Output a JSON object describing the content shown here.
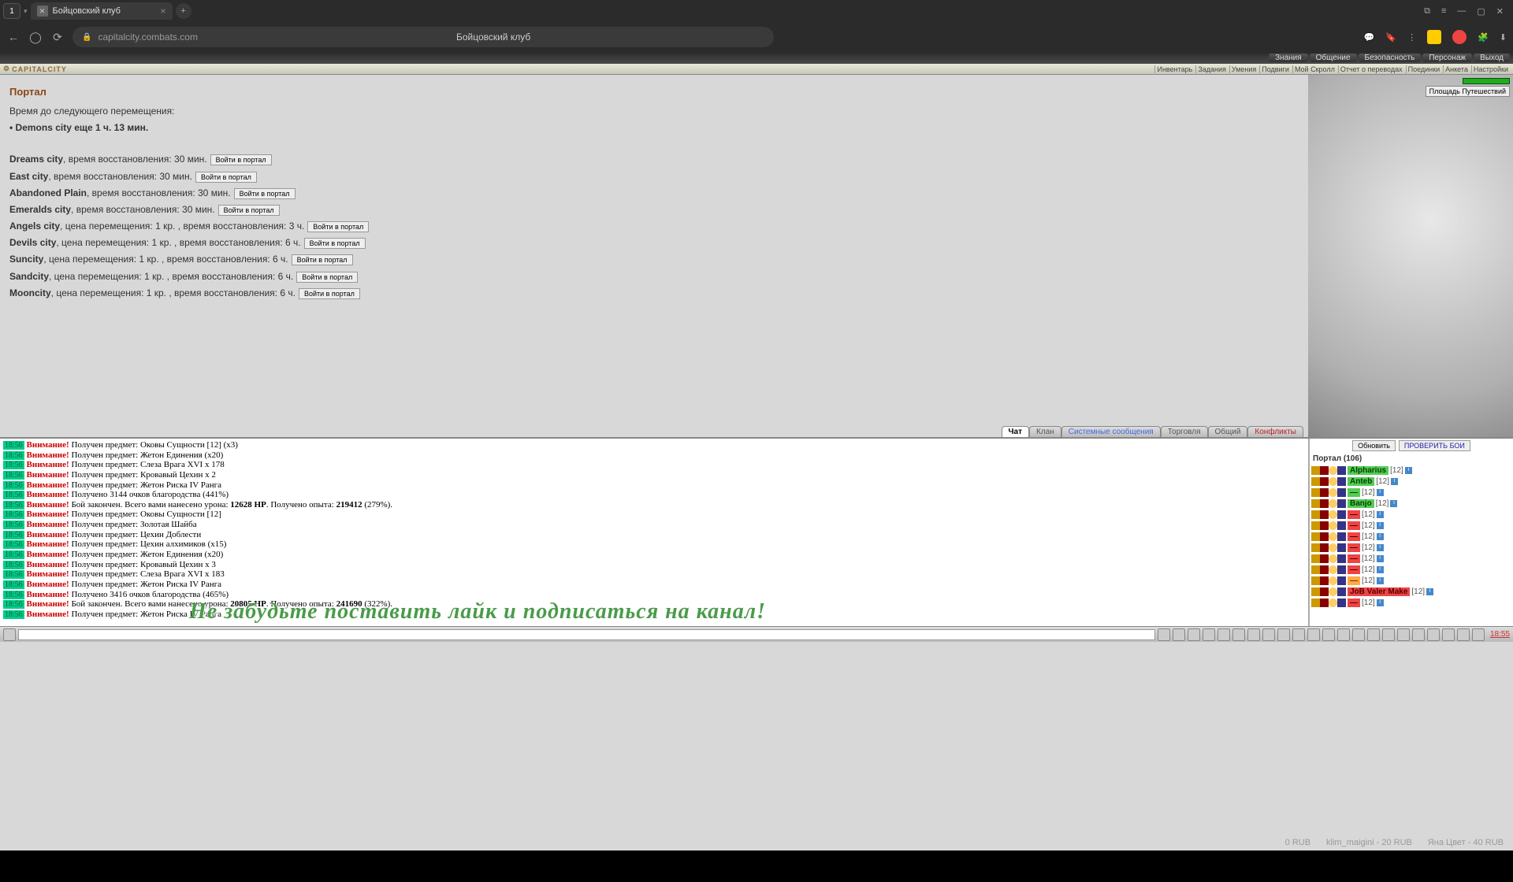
{
  "browser": {
    "profile_num": "1",
    "tab_title": "Бойцовский клуб",
    "url": "capitalcity.combats.com",
    "page_label": "Бойцовский клуб"
  },
  "game_topnav": [
    "Знания",
    "Общение",
    "Безопасность",
    "Персонаж",
    "Выход"
  ],
  "game_menubar_logo": "CAPITALCITY",
  "game_menubar": [
    "Инвентарь",
    "Задания",
    "Умения",
    "Подвиги",
    "Мой Скролл",
    "Отчет о переводах",
    "Поединки",
    "Анкета",
    "Настройки"
  ],
  "portal": {
    "title": "Портал",
    "next_label": "Время до следующего перемещения:",
    "next_line": "• Demons city еще 1 ч. 13 мин.",
    "enter_label": "Войти в портал",
    "dests": [
      {
        "name": "Dreams city",
        "rest": ", время восстановления: 30 мин."
      },
      {
        "name": "East city",
        "rest": ", время восстановления: 30 мин."
      },
      {
        "name": "Abandoned Plain",
        "rest": ", время восстановления: 30 мин."
      },
      {
        "name": "Emeralds city",
        "rest": ", время восстановления: 30 мин."
      },
      {
        "name": "Angels city",
        "rest": ", цена перемещения: 1 кр. , время восстановления: 3 ч."
      },
      {
        "name": "Devils city",
        "rest": ", цена перемещения: 1 кр. , время восстановления: 6 ч."
      },
      {
        "name": "Suncity",
        "rest": ", цена перемещения: 1 кр. , время восстановления: 6 ч."
      },
      {
        "name": "Sandcity",
        "rest": ", цена перемещения: 1 кр. , время восстановления: 6 ч."
      },
      {
        "name": "Mooncity",
        "rest": ", цена перемещения: 1 кр. , время восстановления: 6 ч."
      }
    ]
  },
  "scene": {
    "loc_button": "Площадь Путешествий"
  },
  "market": [
    "0 RUB",
    "klim_maigini - 20 RUB",
    "Яна Цвет - 40 RUB"
  ],
  "chat_tabs": [
    "Чат",
    "Клан",
    "Системные сообщения",
    "Торговля",
    "Общий",
    "Конфликты"
  ],
  "chat_log": [
    {
      "t": "18:56",
      "w": "Внимание!",
      "m": " Получен предмет: Оковы Сущности [12] (x3)"
    },
    {
      "t": "18:56",
      "w": "Внимание!",
      "m": " Получен предмет: Жетон Единения (x20)"
    },
    {
      "t": "18:56",
      "w": "Внимание!",
      "m": " Получен предмет: Слеза Врага XVI x 178"
    },
    {
      "t": "18:56",
      "w": "Внимание!",
      "m": " Получен предмет: Кровавый Цехин x 2"
    },
    {
      "t": "18:56",
      "w": "Внимание!",
      "m": " Получен предмет: Жетон Риска IV Ранга"
    },
    {
      "t": "18:56",
      "w": "Внимание!",
      "m": " Получено 3144 очков благородства (441%)"
    },
    {
      "t": "18:56",
      "w": "Внимание!",
      "m_pre": " Бой закончен. Всего вами нанесено урона: ",
      "hp": "12628 HP",
      "m_mid": ". Получено опыта: ",
      "exp": "219412",
      "m_post": " (279%)."
    },
    {
      "t": "18:56",
      "w": "Внимание!",
      "m": " Получен предмет: Оковы Сущности [12]"
    },
    {
      "t": "18:56",
      "w": "Внимание!",
      "m": " Получен предмет: Золотая Шайба"
    },
    {
      "t": "18:56",
      "w": "Внимание!",
      "m": " Получен предмет: Цехин Доблести"
    },
    {
      "t": "18:56",
      "w": "Внимание!",
      "m": " Получен предмет: Цехин алхимиков (x15)"
    },
    {
      "t": "18:56",
      "w": "Внимание!",
      "m": " Получен предмет: Жетон Единения (x20)"
    },
    {
      "t": "18:56",
      "w": "Внимание!",
      "m": " Получен предмет: Кровавый Цехин x 3"
    },
    {
      "t": "18:56",
      "w": "Внимание!",
      "m": " Получен предмет: Слеза Врага XVI x 183"
    },
    {
      "t": "18:56",
      "w": "Внимание!",
      "m": " Получен предмет: Жетон Риска IV Ранга"
    },
    {
      "t": "18:56",
      "w": "Внимание!",
      "m": " Получено 3416 очков благородства (465%)"
    },
    {
      "t": "18:56",
      "w": "Внимание!",
      "m_pre": " Бой закончен. Всего вами нанесено урона: ",
      "hp": "20805 HP",
      "m_mid": ". Получено опыта: ",
      "exp": "241690",
      "m_post": " (322%)."
    },
    {
      "t": "18:56",
      "w": "Внимание!",
      "m": " Получен предмет: Жетон Риска IV Ранга"
    }
  ],
  "overlay": "Не забудьте поставить лайк и подписаться на канал!",
  "online": {
    "refresh": "Обновить",
    "checkfights": "ПРОВЕРИТЬ БОИ",
    "header": "Портал (106)",
    "players": [
      {
        "name": "Alpharius",
        "cls": "pn-green",
        "lvl": "[12]"
      },
      {
        "name": "Anteb",
        "cls": "pn-green",
        "lvl": "[12]"
      },
      {
        "name": "—",
        "cls": "pn-green",
        "lvl": "[12]"
      },
      {
        "name": "Banjo",
        "cls": "pn-green",
        "lvl": "[12]"
      },
      {
        "name": "—",
        "cls": "pn-red",
        "lvl": "[12]"
      },
      {
        "name": "—",
        "cls": "pn-red",
        "lvl": "[12]"
      },
      {
        "name": "—",
        "cls": "pn-red",
        "lvl": "[12]"
      },
      {
        "name": "—",
        "cls": "pn-red",
        "lvl": "[12]"
      },
      {
        "name": "—",
        "cls": "pn-red",
        "lvl": "[12]"
      },
      {
        "name": "—",
        "cls": "pn-red",
        "lvl": "[12]"
      },
      {
        "name": "—",
        "cls": "pn-orange",
        "lvl": "[12]"
      },
      {
        "name": "JoB Valer Make",
        "cls": "pn-red",
        "lvl": "[12]"
      },
      {
        "name": "—",
        "cls": "pn-red",
        "lvl": "[12]"
      }
    ]
  },
  "clock": "18:55"
}
